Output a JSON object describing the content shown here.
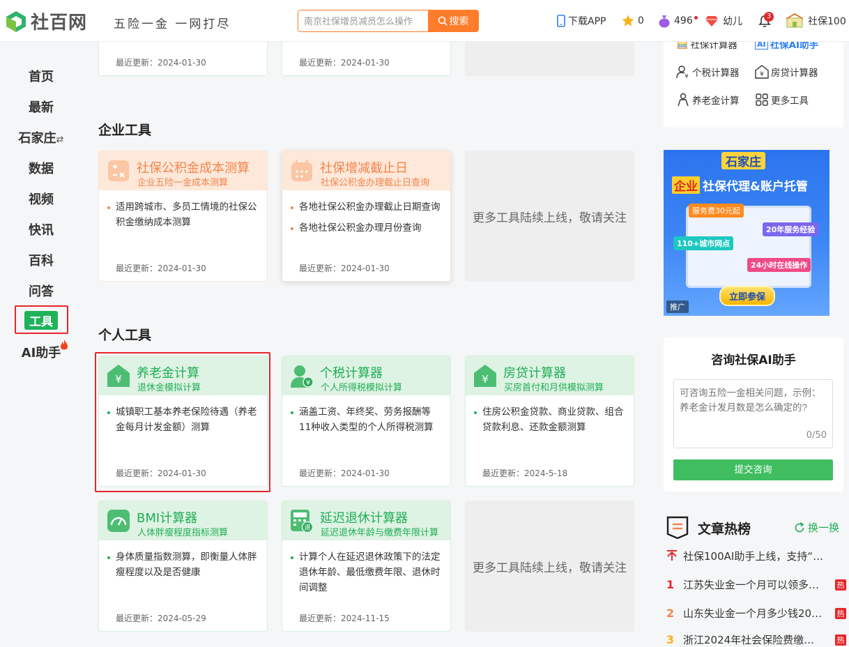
{
  "site": {
    "name": "社百网",
    "slogan": "五险一金  一网打尽"
  },
  "search": {
    "placeholder": "南京社保增员减员怎么操作",
    "button": "搜索"
  },
  "header": {
    "download": "下载APP",
    "stars": "0",
    "points": "496",
    "level": "幼儿",
    "bell_count": "3",
    "user": "社保100"
  },
  "nav": [
    "首页",
    "最新",
    "石家庄",
    "数据",
    "视频",
    "快讯",
    "百科",
    "问答",
    "工具",
    "AI助手"
  ],
  "top_cards": [
    {
      "updated": "最近更新：2024-01-30"
    },
    {
      "updated": "最近更新：2024-01-30"
    }
  ],
  "enterprise": {
    "title": "企业工具",
    "cards": [
      {
        "title": "社保公积金成本测算",
        "subtitle": "企业五险一金成本测算",
        "desc": [
          "适用跨城市、多员工情境的社保公积金缴纳成本测算"
        ],
        "updated": "最近更新：2024-01-30",
        "icon": "calculator-icon"
      },
      {
        "title": "社保增减截止日",
        "subtitle": "社保公积金办理截止日查询",
        "desc": [
          "各地社保公积金办理截止日期查询",
          "各地社保公积金办理月份查询"
        ],
        "updated": "最近更新：2024-01-30",
        "icon": "calendar-icon"
      }
    ],
    "more": "更多工具陆续上线，敬请关注"
  },
  "personal": {
    "title": "个人工具",
    "cards": [
      {
        "title": "养老金计算",
        "subtitle": "退休金模拟计算",
        "desc": [
          "城镇职工基本养老保险待遇（养老金每月计发金额）测算"
        ],
        "updated": "最近更新：2024-01-30",
        "icon": "yuan-house-icon"
      },
      {
        "title": "个税计算器",
        "subtitle": "个人所得税模拟计算",
        "desc": [
          "涵盖工资、年终奖、劳务报酬等11种收入类型的个人所得税测算"
        ],
        "updated": "最近更新：2024-01-30",
        "icon": "person-yuan-icon"
      },
      {
        "title": "房贷计算器",
        "subtitle": "买房首付和月供模拟测算",
        "desc": [
          "住房公积金贷款、商业贷款、组合贷款利息、还款金额测算"
        ],
        "updated": "最近更新：2024-5-18",
        "icon": "yuan-house-icon"
      },
      {
        "title": "BMI计算器",
        "subtitle": "人体胖瘦程度指标测算",
        "desc": [
          "身体质量指数测算，即衡量人体胖瘦程度以及是否健康"
        ],
        "updated": "最近更新：2024-05-29",
        "icon": "gauge-icon"
      },
      {
        "title": "延迟退休计算器",
        "subtitle": "延迟退休年龄与缴费年限计算",
        "desc": [
          "计算个人在延迟退休政策下的法定退休年龄、最低缴费年限、退休时间调整"
        ],
        "updated": "最近更新：2024-11-15",
        "icon": "calculator-retire-icon"
      }
    ],
    "more": "更多工具陆续上线，敬请关注"
  },
  "right_tools": [
    "社保计算器",
    "社保AI助手",
    "个税计算器",
    "房贷计算器",
    "养老金计算",
    "更多工具"
  ],
  "banner": {
    "city": "石家庄",
    "line1_tag": "企业",
    "line1": "社保代理&账户托管",
    "tag1": "服务费30元起",
    "tag2": "110+城市网点",
    "tag3": "20年服务经验",
    "tag4": "24小时在线操作",
    "cta": "立即参保",
    "ad": "推广"
  },
  "ai": {
    "title": "咨询社保AI助手",
    "placeholder": "可咨询五险一金相关问题，示例：养老金计发月数是怎么确定的?",
    "count": "0/50",
    "submit": "提交咨询"
  },
  "hot": {
    "title": "文章热榜",
    "refresh": "换一换",
    "items": [
      {
        "rank": "",
        "text": "社保100AI助手上线，支持“…",
        "hot": ""
      },
      {
        "rank": "1",
        "text": "江苏失业金一个月可以领多…",
        "hot": "热"
      },
      {
        "rank": "2",
        "text": "山东失业金一个月多少钱20…",
        "hot": "热"
      },
      {
        "rank": "3",
        "text": "浙江2024年社会保险费缴…",
        "hot": "热"
      }
    ]
  },
  "colors": {
    "orange": "#f2854a",
    "green": "#1fae55",
    "search": "#ff7c2a",
    "red": "#e5262a"
  }
}
